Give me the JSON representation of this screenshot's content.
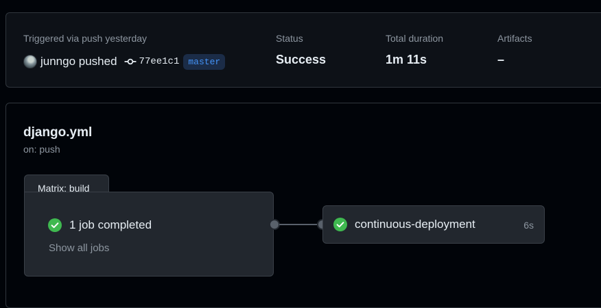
{
  "summary": {
    "trigger_label": "Triggered via push yesterday",
    "actor_text": "junngo pushed",
    "commit_sha": "77ee1c1",
    "branch": "master",
    "status_label": "Status",
    "status_value": "Success",
    "duration_label": "Total duration",
    "duration_value": "1m 11s",
    "artifacts_label": "Artifacts",
    "artifacts_value": "–"
  },
  "workflow": {
    "file_name": "django.yml",
    "trigger": "on: push",
    "matrix": {
      "tab_label": "Matrix: build",
      "summary_text": "1 job completed",
      "show_all_label": "Show all jobs"
    },
    "jobs": [
      {
        "name": "continuous-deployment",
        "duration": "6s",
        "status": "success"
      }
    ]
  },
  "icons": {
    "success": "check-circle-fill-icon",
    "commit": "git-commit-icon"
  },
  "colors": {
    "success": "#3fb950",
    "link": "#4493f8",
    "background": "#010409",
    "panel": "#0d1117",
    "node": "#22272e"
  }
}
